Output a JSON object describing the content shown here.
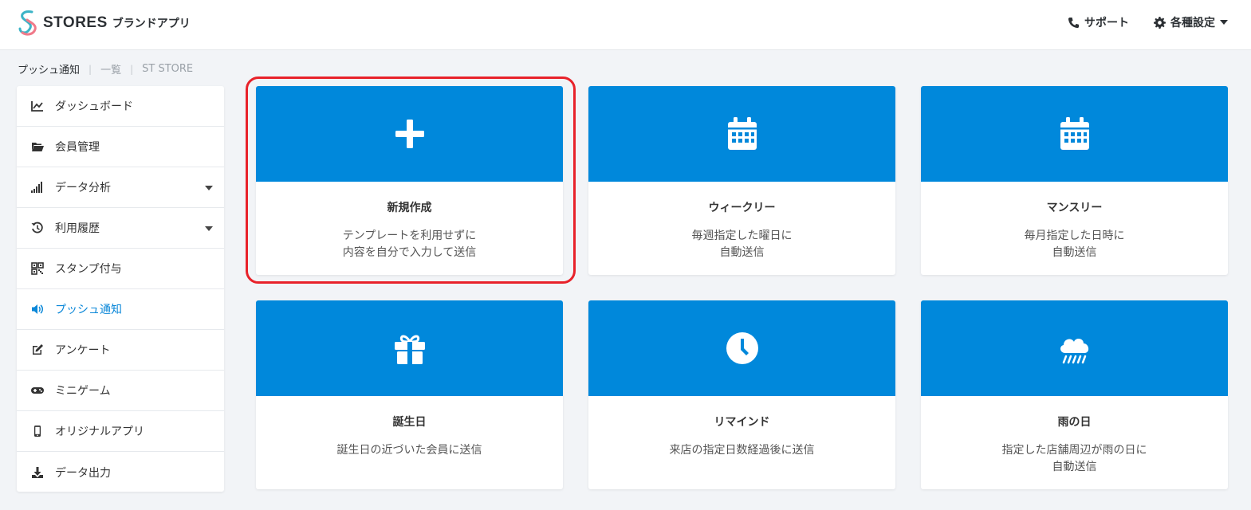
{
  "app": {
    "brand": "STORES",
    "brand_sub": "ブランドアプリ"
  },
  "header": {
    "support_label": "サポート",
    "settings_label": "各種設定"
  },
  "breadcrumb": [
    "プッシュ通知",
    "一覧",
    "ST STORE"
  ],
  "sidebar": {
    "items": [
      {
        "label": "ダッシュボード"
      },
      {
        "label": "会員管理"
      },
      {
        "label": "データ分析"
      },
      {
        "label": "利用履歴"
      },
      {
        "label": "スタンプ付与"
      },
      {
        "label": "プッシュ通知"
      },
      {
        "label": "アンケート"
      },
      {
        "label": "ミニゲーム"
      },
      {
        "label": "オリジナルアプリ"
      },
      {
        "label": "データ出力"
      }
    ]
  },
  "cards": [
    {
      "title": "新規作成",
      "desc1": "テンプレートを利用せずに",
      "desc2": "内容を自分で入力して送信"
    },
    {
      "title": "ウィークリー",
      "desc1": "毎週指定した曜日に",
      "desc2": "自動送信"
    },
    {
      "title": "マンスリー",
      "desc1": "毎月指定した日時に",
      "desc2": "自動送信"
    },
    {
      "title": "誕生日",
      "desc1": "誕生日の近づいた会員に送信",
      "desc2": ""
    },
    {
      "title": "リマインド",
      "desc1": "来店の指定日数経過後に送信",
      "desc2": ""
    },
    {
      "title": "雨の日",
      "desc1": "指定した店舗周辺が雨の日に",
      "desc2": "自動送信"
    }
  ],
  "colors": {
    "accent": "#0088db",
    "active_text": "#0a87d8",
    "highlight": "#e8222a"
  }
}
